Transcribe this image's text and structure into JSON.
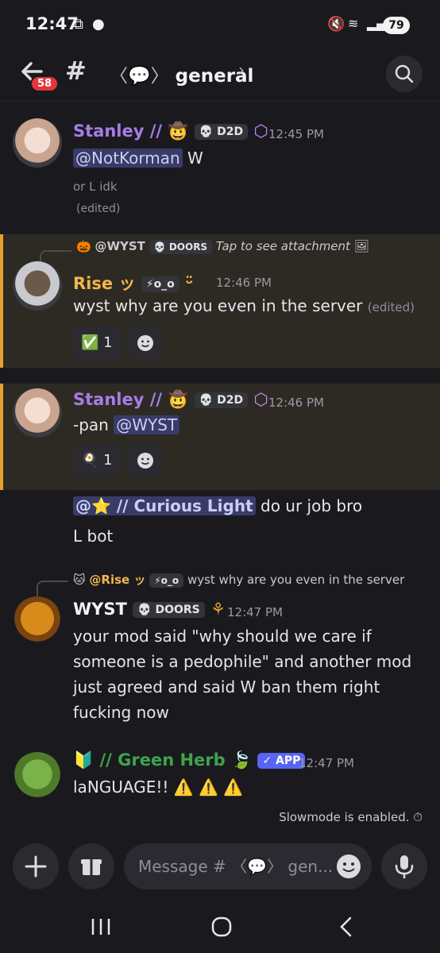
{
  "status_bar": {
    "time": "12:47",
    "battery": "79"
  },
  "header": {
    "unread_count": "58",
    "channel_name": "general"
  },
  "messages": [
    {
      "username": "Stanley //",
      "tag": "D2D",
      "time": "12:45 PM",
      "mention": "@NotKorman",
      "text": " W",
      "line2": "or L idk",
      "edited": "(edited)"
    },
    {
      "reply_user": "@WYST",
      "reply_tag": "DOORS",
      "reply_text": "Tap to see attachment",
      "username": "Rise ッ",
      "tag": "⚡o_o",
      "time": "12:46 PM",
      "text": "wyst why are you even in the server",
      "edited": "(edited)",
      "reaction_emoji": "✅",
      "reaction_count": "1"
    },
    {
      "username": "Stanley //",
      "tag": "D2D",
      "time": "12:46 PM",
      "text": "-pan ",
      "mention": "@WYST",
      "reaction_emoji": "🍳",
      "reaction_count": "1"
    },
    {
      "mention": "@⭐ // Curious Light",
      "text": " do ur job bro",
      "line2": "L bot"
    },
    {
      "reply_user": "@Rise ッ",
      "reply_tag": "⚡o_o",
      "reply_text": "wyst why are you even in the server",
      "username": "WYST",
      "tag": "DOORS",
      "time": "12:47 PM",
      "lines": [
        "your mod said \"why should we care if",
        "someone is a pedophile\" and another mod",
        "just agreed and said W ban them right",
        "fucking now"
      ]
    },
    {
      "username": "🔰 // Green Herb",
      "app_tag": "✓ APP",
      "time": "12:47 PM",
      "text": "laNGUAGE!! ⚠️ ⚠️ ⚠️"
    }
  ],
  "slowmode": "Slowmode is enabled.",
  "composer": {
    "placeholder": "Message # 〈💬〉 gen..."
  },
  "colors": {
    "stanley": "#a77de8",
    "rise": "#f0b64a",
    "green_herb": "#3fa34d",
    "accent": "#e0a330"
  }
}
